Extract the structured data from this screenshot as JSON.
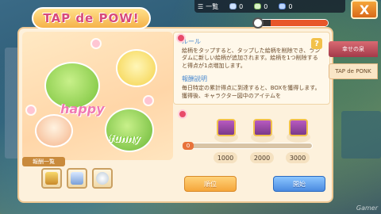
{
  "topbar": {
    "dropdown_label": "一覧",
    "resources": [
      {
        "icon": "gem-icon",
        "value": "0"
      },
      {
        "icon": "green-gem-icon",
        "value": "0"
      },
      {
        "icon": "blue-gem-icon",
        "value": "0"
      }
    ]
  },
  "window": {
    "title": "TAP de POW!",
    "close_label": "X"
  },
  "art": {
    "text_happy": "happy",
    "text_funny": "funny"
  },
  "rewards": {
    "label": "報酬一覧",
    "slots": [
      {
        "icon": "gold-chest-icon"
      },
      {
        "icon": "costume-icon"
      },
      {
        "icon": "shell-icon"
      }
    ]
  },
  "rules": {
    "rule_heading": "ルール",
    "rule_text": "絵柄をタップすると、タップした絵柄を削除でき、ランダムに新しい絵柄が追加されます。絵柄を1つ削除すると得点が1点増加します。",
    "reward_heading": "報酬説明",
    "reward_text": "毎日特定の累計得点に到達すると、BOXを獲得します。獲得後、キャラクター図中のアイテムを"
  },
  "progress": {
    "start_value": "0",
    "fraction": 0.0,
    "milestones": [
      "1000",
      "2000",
      "3000"
    ]
  },
  "buttons": {
    "rank_label": "順位",
    "start_label": "開始"
  },
  "side_tabs": [
    {
      "label": "幸せの泉"
    },
    {
      "label": "TAP de PONK"
    }
  ],
  "watermark": "Gamer"
}
